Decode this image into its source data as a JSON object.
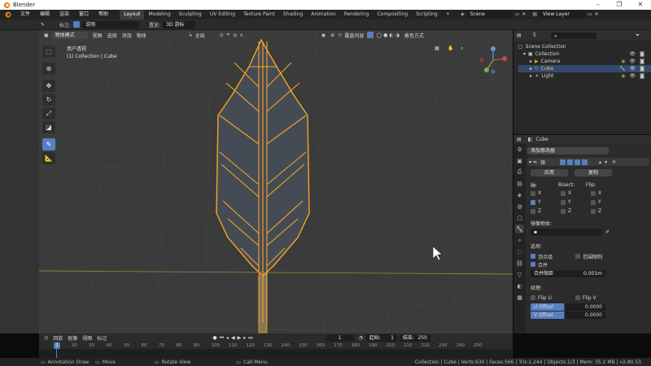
{
  "window": {
    "title": "Blender",
    "controls": [
      "–",
      "❐",
      "✕"
    ]
  },
  "menu": [
    "文件",
    "编辑",
    "渲染",
    "窗口",
    "帮助"
  ],
  "workspace_tabs": [
    "Layout",
    "Modeling",
    "Sculpting",
    "UV Editing",
    "Texture Paint",
    "Shading",
    "Animation",
    "Rendering",
    "Compositing",
    "Scripting"
  ],
  "active_tab": "Layout",
  "scene": {
    "label": "Scene",
    "view_layer": "View Layer"
  },
  "toolheader": {
    "annotation_label": "标注:",
    "annotation_value": "说明",
    "placement_label": "置放:",
    "placement_value": "3D 游标"
  },
  "viewport": {
    "mode": "物体模式",
    "menus": [
      "视图",
      "选择",
      "添加",
      "物体"
    ],
    "orientation": "全局",
    "overlay_label": "覆盖内容",
    "shading_label": "着色方式",
    "info_line1": "用户透视",
    "info_line2": "(1) Collection | Cube"
  },
  "outliner": {
    "search_placeholder": "",
    "root": "Scene Collection",
    "collection": "Collection",
    "items": [
      "Camera",
      "Cube",
      "Light"
    ]
  },
  "properties": {
    "object_name": "Cube",
    "add_modifier": "添加修改器",
    "modifier_name": "镜",
    "apply": "应用",
    "copy": "复制",
    "axis_label": "轴:",
    "bisect_label": "Bisect:",
    "flip_label": "Flip:",
    "axes": [
      "X",
      "Y",
      "Z"
    ],
    "axis_checked": [
      false,
      true,
      false
    ],
    "mirror_object_label": "镜像物体:",
    "options_label": "选项:",
    "vertex_groups": "顶点组",
    "clipping": "范围限制",
    "merge": "合并",
    "merge_limit_label": "合并限距",
    "merge_limit_value": "0.001m",
    "textures_label": "纹理:",
    "flip_u": "Flip U",
    "flip_v": "Flip V",
    "u_offset_label": "U Offset",
    "u_offset_value": "0.0000",
    "v_offset_label": "V Offset",
    "v_offset_value": "0.0000"
  },
  "timeline": {
    "menus": [
      "回放",
      "抠像",
      "视图",
      "标记"
    ],
    "current_frame": "1",
    "start_label": "起始:",
    "start": "1",
    "end_label": "结束:",
    "end": "250",
    "ticks": [
      "10",
      "20",
      "30",
      "40",
      "50",
      "60",
      "70",
      "80",
      "90",
      "100",
      "110",
      "120",
      "130",
      "140",
      "150",
      "160",
      "170",
      "180",
      "190",
      "200",
      "210",
      "220",
      "230",
      "240",
      "250"
    ]
  },
  "status": {
    "left1": "Annotation Draw",
    "left2": "Move",
    "left3": "Rotate View",
    "left4": "Call Menu",
    "right": "Collection | Cube | Verts:630 | Faces:566 | Tris:1,244 | Objects:1/3 | Mem: 35.2 MB | v2.80.53"
  },
  "colors": {
    "accent": "#5680c2",
    "selection": "#f5a623",
    "bg": "#3b3b3b"
  }
}
